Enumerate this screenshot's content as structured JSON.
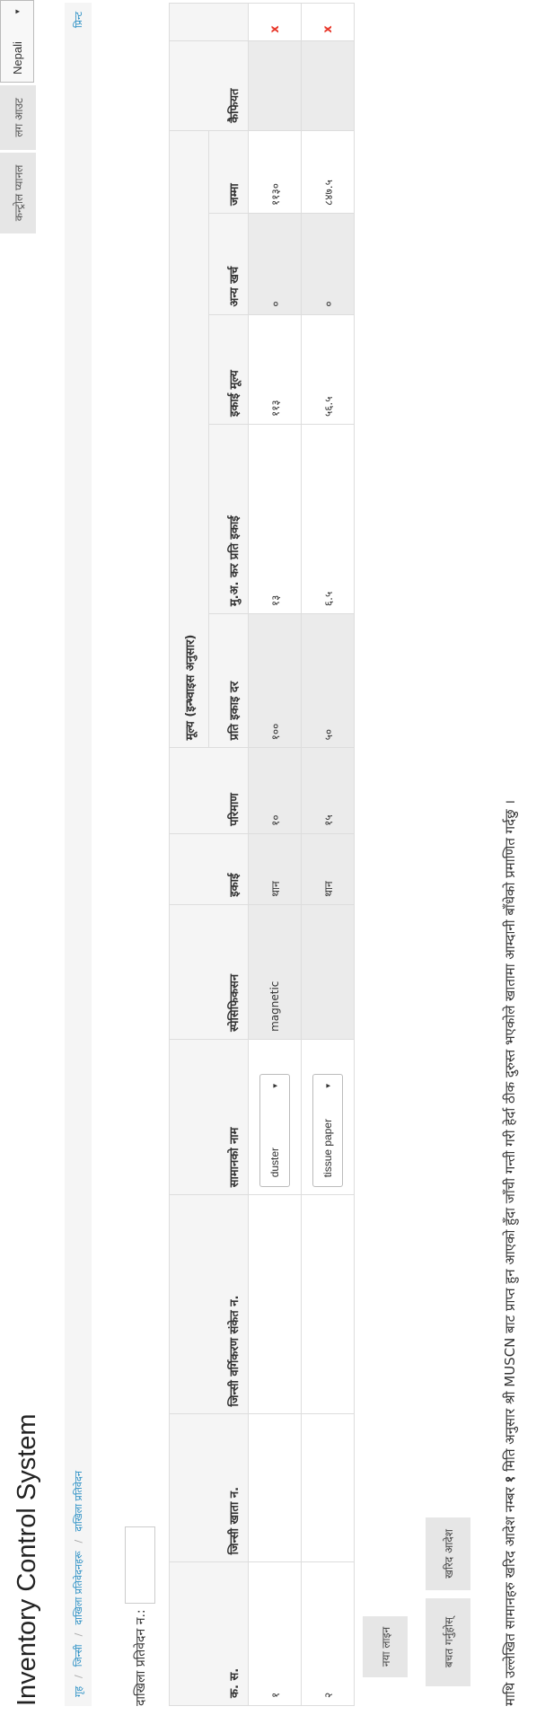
{
  "app": {
    "title": "Inventory Control System"
  },
  "header": {
    "control_panel": "कन्ट्रोल प्यानल",
    "logout": "लग आउट",
    "language": "Nepali"
  },
  "breadcrumb": {
    "items": [
      "गृह",
      "जिन्सी",
      "दाखिला प्रतिवेदनहरू",
      "दाखिला प्रतिवेदन"
    ],
    "print": "प्रिन्ट"
  },
  "report": {
    "label": "दाखिला प्रतिवेदन न.:",
    "value": ""
  },
  "table": {
    "headers": {
      "sn": "क. स.",
      "account_no": "जिन्सी खाता न.",
      "class_code": "जिन्सी वर्गिकरण संकेत न.",
      "item_name": "सामानको नाम",
      "spec": "स्पेसिफिकसन",
      "unit": "इकाई",
      "qty": "परिमाण",
      "price_group": "मूल्य (इन्भ्वाइस अनुसार)",
      "rate": "प्रति इकाइ दर",
      "vat": "मु.अ. कर प्रति इकाई",
      "unit_price": "इकाई मूल्य",
      "other_cost": "अन्य खर्च",
      "total": "जम्मा",
      "remarks": "कैफियत"
    },
    "rows": [
      {
        "sn": "१",
        "account_no": "",
        "class_code": "",
        "item_name": "duster",
        "spec": "magnetic",
        "unit": "थान",
        "qty": "१०",
        "rate": "१००",
        "vat": "१३",
        "unit_price": "११३",
        "other_cost": "०",
        "total": "११३०",
        "remarks": "",
        "delete": "x"
      },
      {
        "sn": "२",
        "account_no": "",
        "class_code": "",
        "item_name": "tissue paper",
        "spec": "",
        "unit": "थान",
        "qty": "१५",
        "rate": "५०",
        "vat": "६.५",
        "unit_price": "५६.५",
        "other_cost": "०",
        "total": "८४७.५",
        "remarks": "",
        "delete": "x"
      }
    ]
  },
  "buttons": {
    "new_row": "नया लाइन",
    "save": "बचत गर्नुहोस्",
    "purchase_order": "खरिद आदेश"
  },
  "certification": {
    "before": "माथि उल्लेखित सामानहरु खरिद आदेश नम्बर",
    "order_no": "१",
    "middle": "मिति अनुसार श्री MUSCN बाट प्राप्त हुन आएको हुँदा जाँची गन्ती गरी हेर्दा ठीक दुरुस्त भएकोले खातामा आम्दानी बाँधेको प्रमाणित गर्दछु ।"
  }
}
